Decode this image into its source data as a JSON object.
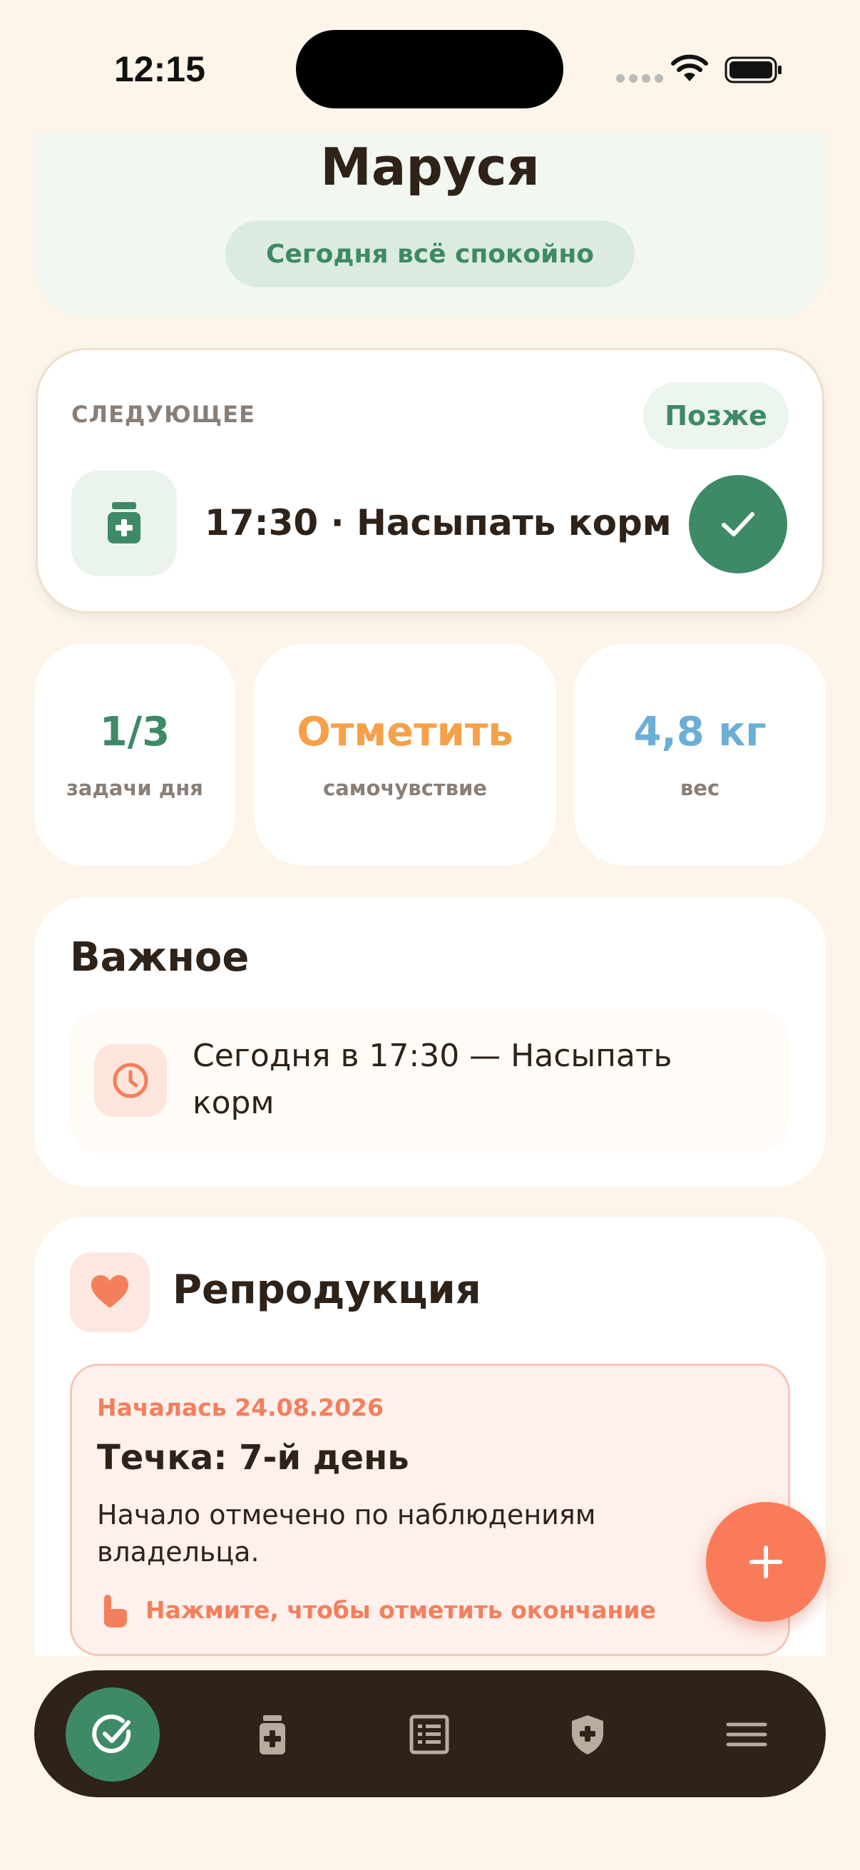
{
  "status_bar": {
    "time": "12:15"
  },
  "pet": {
    "name": "Маруся",
    "status": "Сегодня всё спокойно"
  },
  "next": {
    "label": "СЛЕДУЮЩЕЕ",
    "later_label": "Позже",
    "task": "17:30 · Насыпать корм"
  },
  "stats": {
    "tasks": {
      "value": "1/3",
      "label": "задачи дня",
      "color": "#3E8A66"
    },
    "wellbeing": {
      "value": "Отметить",
      "label": "самочувствие",
      "color": "#F6A04A"
    },
    "weight": {
      "value": "4,8 кг",
      "label": "вес",
      "color": "#6BAED6"
    }
  },
  "important": {
    "title": "Важное",
    "items": [
      {
        "text": "Сегодня в 17:30 — Насыпать корм"
      }
    ]
  },
  "reproduction": {
    "title": "Репродукция",
    "started": "Началась 24.08.2026",
    "state": "Течка: 7-й день",
    "description": "Начало отмечено по наблюдениям владельца.",
    "action": "Нажмите, чтобы отметить окончание"
  },
  "nav": {
    "items": [
      {
        "icon": "check-circle-icon",
        "active": true
      },
      {
        "icon": "medicine-icon",
        "active": false
      },
      {
        "icon": "list-icon",
        "active": false
      },
      {
        "icon": "shield-plus-icon",
        "active": false
      },
      {
        "icon": "menu-icon",
        "active": false
      }
    ]
  },
  "colors": {
    "accent_green": "#3E8A66",
    "accent_coral": "#FA7B5A",
    "background": "#FDF4EA",
    "nav_background": "#2E2219"
  }
}
